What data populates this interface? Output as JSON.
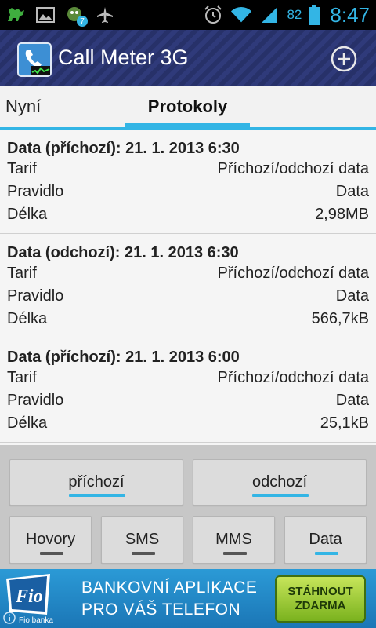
{
  "status_bar": {
    "icons_left": [
      "android-dino-icon",
      "image-icon",
      "notification-badge-icon",
      "airplane-icon"
    ],
    "badge_count": "7",
    "battery_percent": "82",
    "time": "8:47",
    "accent_color": "#33b5e5"
  },
  "app": {
    "title": "Call Meter 3G"
  },
  "tabs": [
    {
      "label": "Nyní",
      "selected": false
    },
    {
      "label": "Protokoly",
      "selected": true
    }
  ],
  "log_entries": [
    {
      "title": "Data (příchozí): 21. 1. 2013 6:30",
      "rows": [
        {
          "label": "Tarif",
          "value": "Příchozí/odchozí data"
        },
        {
          "label": "Pravidlo",
          "value": "Data"
        },
        {
          "label": "Délka",
          "value": "2,98MB"
        }
      ]
    },
    {
      "title": "Data (odchozí): 21. 1. 2013 6:30",
      "rows": [
        {
          "label": "Tarif",
          "value": "Příchozí/odchozí data"
        },
        {
          "label": "Pravidlo",
          "value": "Data"
        },
        {
          "label": "Délka",
          "value": "566,7kB"
        }
      ]
    },
    {
      "title": "Data (příchozí): 21. 1. 2013 6:00",
      "rows": [
        {
          "label": "Tarif",
          "value": "Příchozí/odchozí data"
        },
        {
          "label": "Pravidlo",
          "value": "Data"
        },
        {
          "label": "Délka",
          "value": "25,1kB"
        }
      ]
    }
  ],
  "direction_filters": [
    {
      "label": "příchozí",
      "active": true
    },
    {
      "label": "odchozí",
      "active": true
    }
  ],
  "type_filters": [
    {
      "label": "Hovory",
      "active": false
    },
    {
      "label": "SMS",
      "active": false
    },
    {
      "label": "MMS",
      "active": false
    },
    {
      "label": "Data",
      "active": true
    }
  ],
  "ad": {
    "logo_text": "Fio",
    "bank_text": "Fio banka",
    "line1": "BANKOVNÍ APLIKACE",
    "line2": "PRO VÁŠ TELEFON",
    "cta_line1": "STÁHNOUT",
    "cta_line2": "ZDARMA"
  }
}
